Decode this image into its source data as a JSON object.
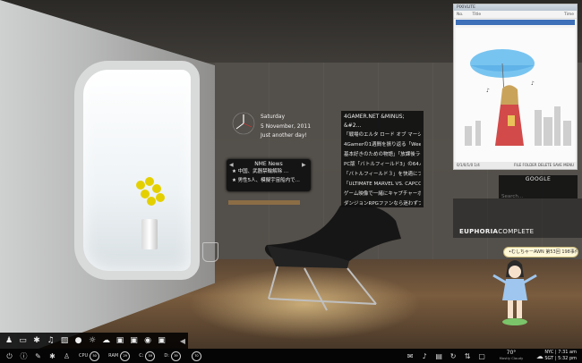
{
  "clock": {
    "day": "Saturday",
    "date": "5 November, 2011",
    "note": "Just another day!"
  },
  "nme": {
    "title": "NME News",
    "items": [
      "★ 中国、武器禁輸解除 ...",
      "★ 男性5人、模擬宇宙船内で..."
    ]
  },
  "feed": {
    "title": "4GAMER.NET &MINUS; &#2...",
    "items": [
      "「戦場のエルタ ロード オブ マーシャル」",
      "4Gamerの1週間を振り返る「Weekly...",
      "基本好きのための物語」「放課後ライト...",
      "PC版「バトルフィールド3」の64人が...",
      "「バトルフィールド３」を快適にプレイで...",
      "「ULTIMATE MARVEL VS. CAPCOM 3...",
      "ゲーム映像で一緒にキャプチャーボ...",
      "ダンジョンRPGファンなら迷わずプレイす..."
    ]
  },
  "viewer": {
    "title_bar": "PIXIVLITE",
    "col_no": "No.",
    "col_title": "Title",
    "col_time": "Time",
    "foot_left": "0/1/0/1/0  1/4",
    "foot_right": "FILE  FOLDER  DELETE  SAVE  MENU"
  },
  "google": {
    "title": "GOOGLE",
    "placeholder": "Search..."
  },
  "euphoria": {
    "bold": "EUPHORIA",
    "rest": "COMPLETE"
  },
  "mascot": {
    "bubble": "•むしちゃーAWN 第53回 198事件"
  },
  "dock": {
    "icons": [
      "person-icon",
      "laptop-icon",
      "gear-icon",
      "music-icon",
      "image-icon",
      "lightbulb-icon",
      "sun-icon",
      "cloud-icon",
      "window-icon",
      "window-icon",
      "globe-icon",
      "window-icon"
    ]
  },
  "taskbar": {
    "cpu_label": "CPU",
    "cpu_value": "50",
    "ram_label": "RAM",
    "ram_value": "29",
    "c_label": "C:",
    "c_value": "59",
    "d_label": "D:",
    "d_value": "39",
    "e_value": "70",
    "weather_temp": "70°",
    "weather_desc": "Mostly Cloudy",
    "time1_label": "NYC",
    "time1": "7:31 am",
    "time2_label": "SGT",
    "time2": "5:32 pm"
  },
  "colors": {
    "accent": "#3d70b8",
    "panel": "#121212"
  }
}
